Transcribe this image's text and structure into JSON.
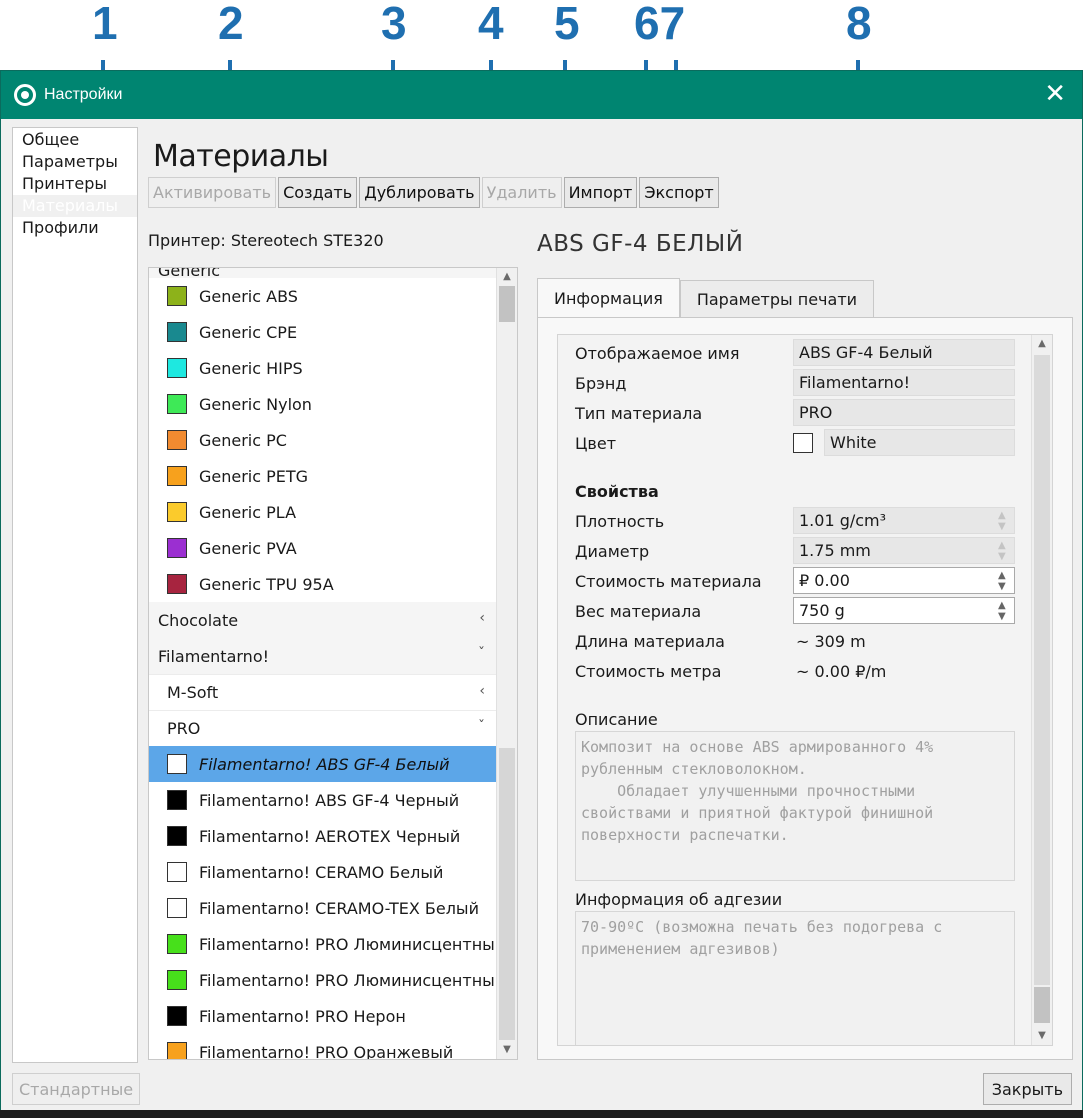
{
  "callouts": [
    "1",
    "2",
    "3",
    "4",
    "5",
    "67",
    "8"
  ],
  "window": {
    "title": "Настройки",
    "close_glyph": "✕"
  },
  "nav": {
    "items": [
      {
        "label": "Общее",
        "selected": false
      },
      {
        "label": "Параметры",
        "selected": false
      },
      {
        "label": "Принтеры",
        "selected": false
      },
      {
        "label": "Материалы",
        "selected": true
      },
      {
        "label": "Профили",
        "selected": false
      }
    ]
  },
  "section_title": "Материалы",
  "toolbar": {
    "activate": "Активировать",
    "create": "Создать",
    "duplicate": "Дублировать",
    "remove": "Удалить",
    "import": "Импорт",
    "export": "Экспорт"
  },
  "printer_label": "Принтер: Stereotech STE320",
  "materials": {
    "generic_header": "Generic",
    "generic_items": [
      {
        "label": "Generic ABS",
        "color": "#8db21a"
      },
      {
        "label": "Generic CPE",
        "color": "#19898f"
      },
      {
        "label": "Generic HIPS",
        "color": "#1ee8e0"
      },
      {
        "label": "Generic Nylon",
        "color": "#3ee957"
      },
      {
        "label": "Generic PC",
        "color": "#f28b30"
      },
      {
        "label": "Generic PETG",
        "color": "#f7a11d"
      },
      {
        "label": "Generic PLA",
        "color": "#fbcb2c"
      },
      {
        "label": "Generic PVA",
        "color": "#9b2fd1"
      },
      {
        "label": "Generic TPU 95A",
        "color": "#a7243f"
      }
    ],
    "brand_chocolate": "Chocolate",
    "brand_filamentarno": "Filamentarno!",
    "sub_msoft": "M-Soft",
    "sub_pro": "PRO",
    "chev_collapsed": "‹",
    "chev_expanded": "ˇ",
    "pro_items": [
      {
        "label": "Filamentarno! ABS GF-4 Белый",
        "color": "#ffffff",
        "selected": true
      },
      {
        "label": "Filamentarno! ABS GF-4 Черный",
        "color": "#000000",
        "selected": false
      },
      {
        "label": "Filamentarno! AEROTEX Черный",
        "color": "#000000",
        "selected": false
      },
      {
        "label": "Filamentarno! CERAMO Белый",
        "color": "#ffffff",
        "selected": false
      },
      {
        "label": "Filamentarno! CERAMO-TEX Белый",
        "color": "#ffffff",
        "selected": false
      },
      {
        "label": "Filamentarno! PRO Люминисцентный",
        "color": "#47e01b",
        "selected": false
      },
      {
        "label": "Filamentarno! PRO Люминисцентный",
        "color": "#47e01b",
        "selected": false
      },
      {
        "label": "Filamentarno! PRO Нерон",
        "color": "#000000",
        "selected": false
      },
      {
        "label": "Filamentarno! PRO Оранжевый",
        "color": "#f7a11d",
        "selected": false
      }
    ]
  },
  "material_title": "ABS GF-4 БЕЛЫЙ",
  "tabs": {
    "info": "Информация",
    "print_params": "Параметры печати"
  },
  "info": {
    "display_name_label": "Отображаемое имя",
    "display_name_value": "ABS GF-4 Белый",
    "brand_label": "Брэнд",
    "brand_value": "Filamentarno!",
    "type_label": "Тип материала",
    "type_value": "PRO",
    "color_label": "Цвет",
    "color_value": "White",
    "properties_head": "Свойства",
    "density_label": "Плотность",
    "density_value": "1.01 g/cm³",
    "diameter_label": "Диаметр",
    "diameter_value": "1.75 mm",
    "cost_label": "Стоимость материала",
    "cost_value": "₽ 0.00",
    "weight_label": "Вес материала",
    "weight_value": "750 g",
    "length_label": "Длина материала",
    "length_value": "~ 309 m",
    "cost_per_m_label": "Стоимость метра",
    "cost_per_m_value": "~ 0.00 ₽/m",
    "description_label": "Описание",
    "description_text": "Композит на основе ABS армированного 4%\nрубленным стекловолокном.\n    Обладает улучшенными прочностными\nсвойствами и приятной фактурой финишной\nповерхности распечатки.",
    "adhesion_label": "Информация об адгезии",
    "adhesion_text": "70-90ºC (возможна печать без подогрева с\nприменением адгезивов)"
  },
  "buttons": {
    "defaults": "Стандартные",
    "close": "Закрыть"
  },
  "accent_color": "#008571",
  "callout_color": "#1f6fb0",
  "selection_color": "#5ca6e8"
}
